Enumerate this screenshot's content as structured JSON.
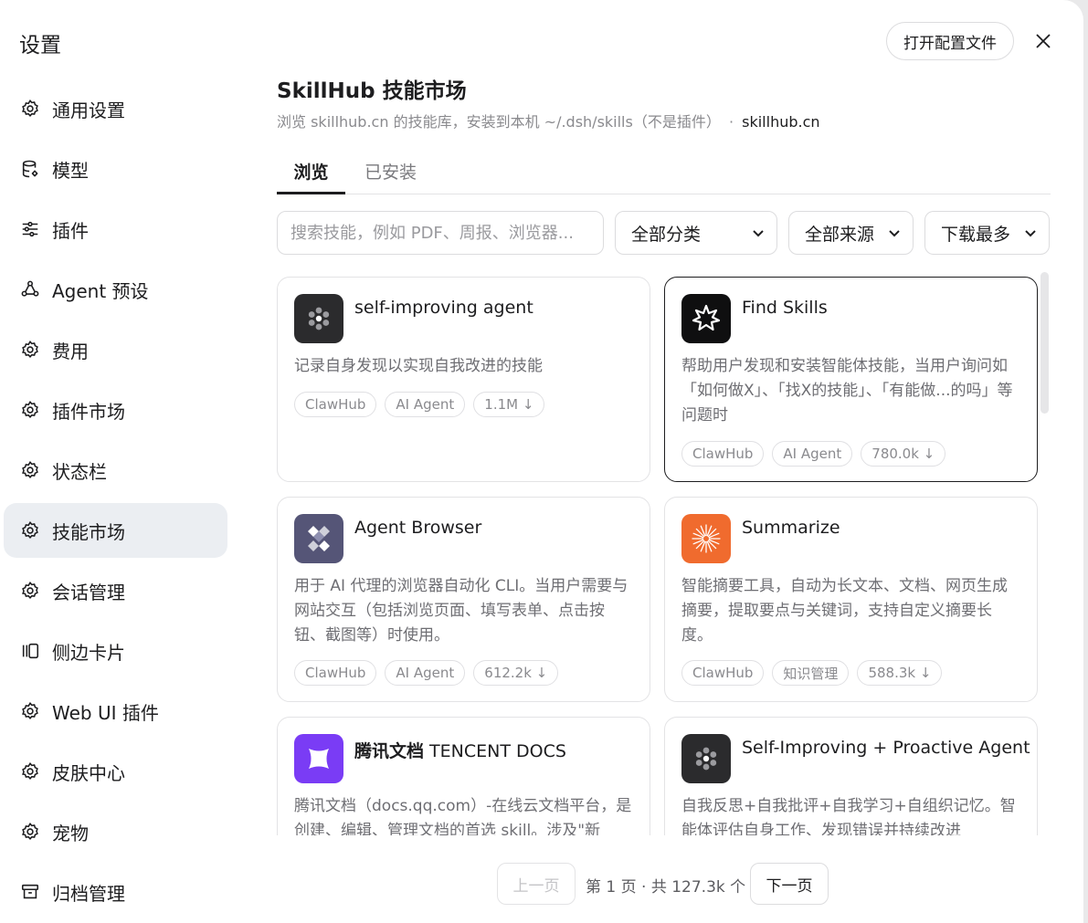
{
  "sidebar": {
    "title": "设置",
    "items": [
      {
        "label": "通用设置",
        "icon": "gear-icon"
      },
      {
        "label": "模型",
        "icon": "database-icon"
      },
      {
        "label": "插件",
        "icon": "sliders-icon"
      },
      {
        "label": "Agent 预设",
        "icon": "agent-icon"
      },
      {
        "label": "费用",
        "icon": "gear-icon"
      },
      {
        "label": "插件市场",
        "icon": "gear-icon"
      },
      {
        "label": "状态栏",
        "icon": "gear-icon"
      },
      {
        "label": "技能市场",
        "icon": "gear-icon",
        "active": true
      },
      {
        "label": "会话管理",
        "icon": "gear-icon"
      },
      {
        "label": "侧边卡片",
        "icon": "side-panel-icon"
      },
      {
        "label": "Web UI 插件",
        "icon": "gear-icon"
      },
      {
        "label": "皮肤中心",
        "icon": "gear-icon"
      },
      {
        "label": "宠物",
        "icon": "gear-icon"
      },
      {
        "label": "归档管理",
        "icon": "archive-icon"
      }
    ]
  },
  "header": {
    "open_config_label": "打开配置文件",
    "close_icon": "close-icon"
  },
  "main": {
    "title": "SkillHub 技能市场",
    "subtitle": "浏览 skillhub.cn 的技能库，安装到本机 ~/.dsh/skills（不是插件）",
    "subtitle_sep": "·",
    "subtitle_link": "skillhub.cn",
    "tabs": [
      {
        "label": "浏览",
        "active": true
      },
      {
        "label": "已安装",
        "active": false
      }
    ],
    "search_placeholder": "搜索技能，例如 PDF、周报、浏览器...",
    "filters": {
      "category": "全部分类",
      "source": "全部来源",
      "sort": "下载最多"
    }
  },
  "cards": [
    {
      "title": "self-improving agent",
      "title_bold": "",
      "desc": "记录自身发现以实现自我改进的技能",
      "tags": [
        "ClawHub",
        "AI Agent",
        "1.1M ↓"
      ],
      "logo_color": "#2b2b2d",
      "logo_icon": "dots-cluster-icon"
    },
    {
      "title": "Find Skills",
      "title_bold": "",
      "desc": "帮助用户发现和安装智能体技能，当用户询问如「如何做X」、「找X的技能」、「有能做...的吗」等问题时",
      "tags": [
        "ClawHub",
        "AI Agent",
        "780.0k ↓"
      ],
      "logo_color": "#0f0f10",
      "logo_icon": "starburst-icon",
      "selected": true
    },
    {
      "title": "Agent Browser",
      "title_bold": "",
      "desc": "用于 AI 代理的浏览器自动化 CLI。当用户需要与网站交互（包括浏览页面、填写表单、点击按钮、截图等）时使用。",
      "tags": [
        "ClawHub",
        "AI Agent",
        "612.2k ↓"
      ],
      "logo_color": "#555577",
      "logo_icon": "diamond-grid-icon"
    },
    {
      "title": "Summarize",
      "title_bold": "",
      "desc": "智能摘要工具，自动为长文本、文档、网页生成摘要，提取要点与关键词，支持自定义摘要长度。",
      "tags": [
        "ClawHub",
        "知识管理",
        "588.3k ↓"
      ],
      "logo_color": "#f06b2e",
      "logo_icon": "sunburst-icon"
    },
    {
      "title": " TENCENT DOCS",
      "title_bold": "腾讯文档",
      "desc": "腾讯文档（docs.qq.com）-在线云文档平台，是创建、编辑、管理文档的首选 skill。涉及\"新",
      "tags": [],
      "logo_color": "#7a3cf5",
      "logo_icon": "tencent-docs-icon"
    },
    {
      "title": "Self-Improving + Proactive Agent",
      "title_bold": "",
      "desc": "自我反思+自我批评+自我学习+自组织记忆。智能体评估自身工作、发现错误并持续改进",
      "tags": [],
      "logo_color": "#2b2b2d",
      "logo_icon": "dots-cluster-icon"
    }
  ],
  "pagination": {
    "prev_label": "上一页",
    "info": "第 1 页 · 共 127.3k 个",
    "next_label": "下一页"
  }
}
